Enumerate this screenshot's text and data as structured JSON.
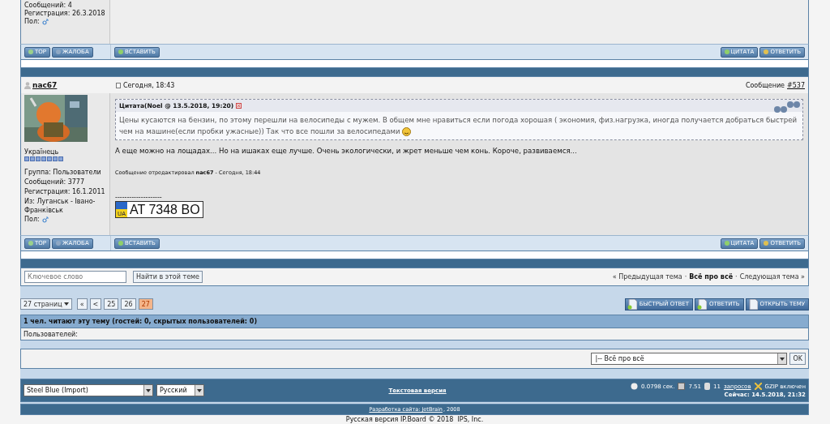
{
  "prev_post": {
    "profile_lines": [
      "Сообщений: 4",
      "Регистрация: 26.3.2018"
    ],
    "gender_label": "Пол:",
    "left_buttons": [
      "TOP",
      "ЖАЛОБА"
    ],
    "insert_button": "ВСТАВИТЬ",
    "right_buttons": [
      "ЦИТАТА",
      "ОТВЕТИТЬ"
    ]
  },
  "post": {
    "author": "nac67",
    "date": "Сегодня, 18:43",
    "number_label": "Сообщение",
    "number_link": "#537",
    "rank": "Українець",
    "profile_lines": [
      "Группа: Пользователи",
      "Сообщений: 3777",
      "Регистрация: 16.1.2011",
      "Из: Луганськ - Івано-Франківськ"
    ],
    "gender_label": "Пол:",
    "quote": {
      "header": "Цитата(Noel @ 13.5.2018, 19:20)",
      "text": "Цены кусаются на бензин, по этому перешли на велосипеды с мужем. В общем мне нравиться если погода хорошая ( экономия, физ.нагрузка, иногда получается добраться быстрей чем на машине(если пробки ужасные)) Так что все пошли за велосипедами"
    },
    "text": "А еще можно на лощадах... Но на ишаках еще лучше. Очень экологически, и жрет меньше чем конь. Короче, развиваемся...",
    "edited": "Сообщение отредактировал **nac67** - Сегодня, 18:44",
    "signature_rule": "--------------------",
    "plate": {
      "country": "UA",
      "number": "AT 7348 BO"
    },
    "left_buttons": [
      "TOP",
      "ЖАЛОБА"
    ],
    "insert_button": "ВСТАВИТЬ",
    "right_buttons": [
      "ЦИТАТА",
      "ОТВЕТИТЬ"
    ]
  },
  "search": {
    "placeholder": "Ключевое слово",
    "button": "Найти в этой теме",
    "prev": "« Предыдущая тема",
    "sep1": "·",
    "current": "Всё про всё",
    "sep2": "·",
    "next": "Следующая тема »"
  },
  "pagination": {
    "pages_select": "27 страниц",
    "items": [
      {
        "label": "«",
        "selected": false
      },
      {
        "label": "<",
        "selected": false
      },
      {
        "label": "25",
        "selected": false
      },
      {
        "label": "26",
        "selected": false
      },
      {
        "label": "27",
        "selected": true
      }
    ],
    "actions": [
      "БЫСТРЫЙ ОТВЕТ",
      "ОТВЕТИТЬ",
      "ОТКРЫТЬ ТЕМУ"
    ]
  },
  "readers": {
    "title": "1 чел. читают эту тему (гостей: 0, скрытых пользователей: 0)",
    "users_label": "Пользователей:"
  },
  "jump": {
    "value": "|-- Всё про всё",
    "button": "OK"
  },
  "footer": {
    "skin": "Steel Blue (Import)",
    "language": "Русский",
    "text_version": "Текстовая версия",
    "time": "0.0798 сек.",
    "load": "7.51",
    "queries_count": "11",
    "queries_link": "запросов",
    "gzip": "GZIP включен",
    "now": "Сейчас: 14.5.2018, 21:32",
    "dev_link": "Разработка сайта: JetBrain",
    "dev_year": ", 2008",
    "copyright": "Русская версия IP.Board © 2018  IPS, Inc."
  }
}
